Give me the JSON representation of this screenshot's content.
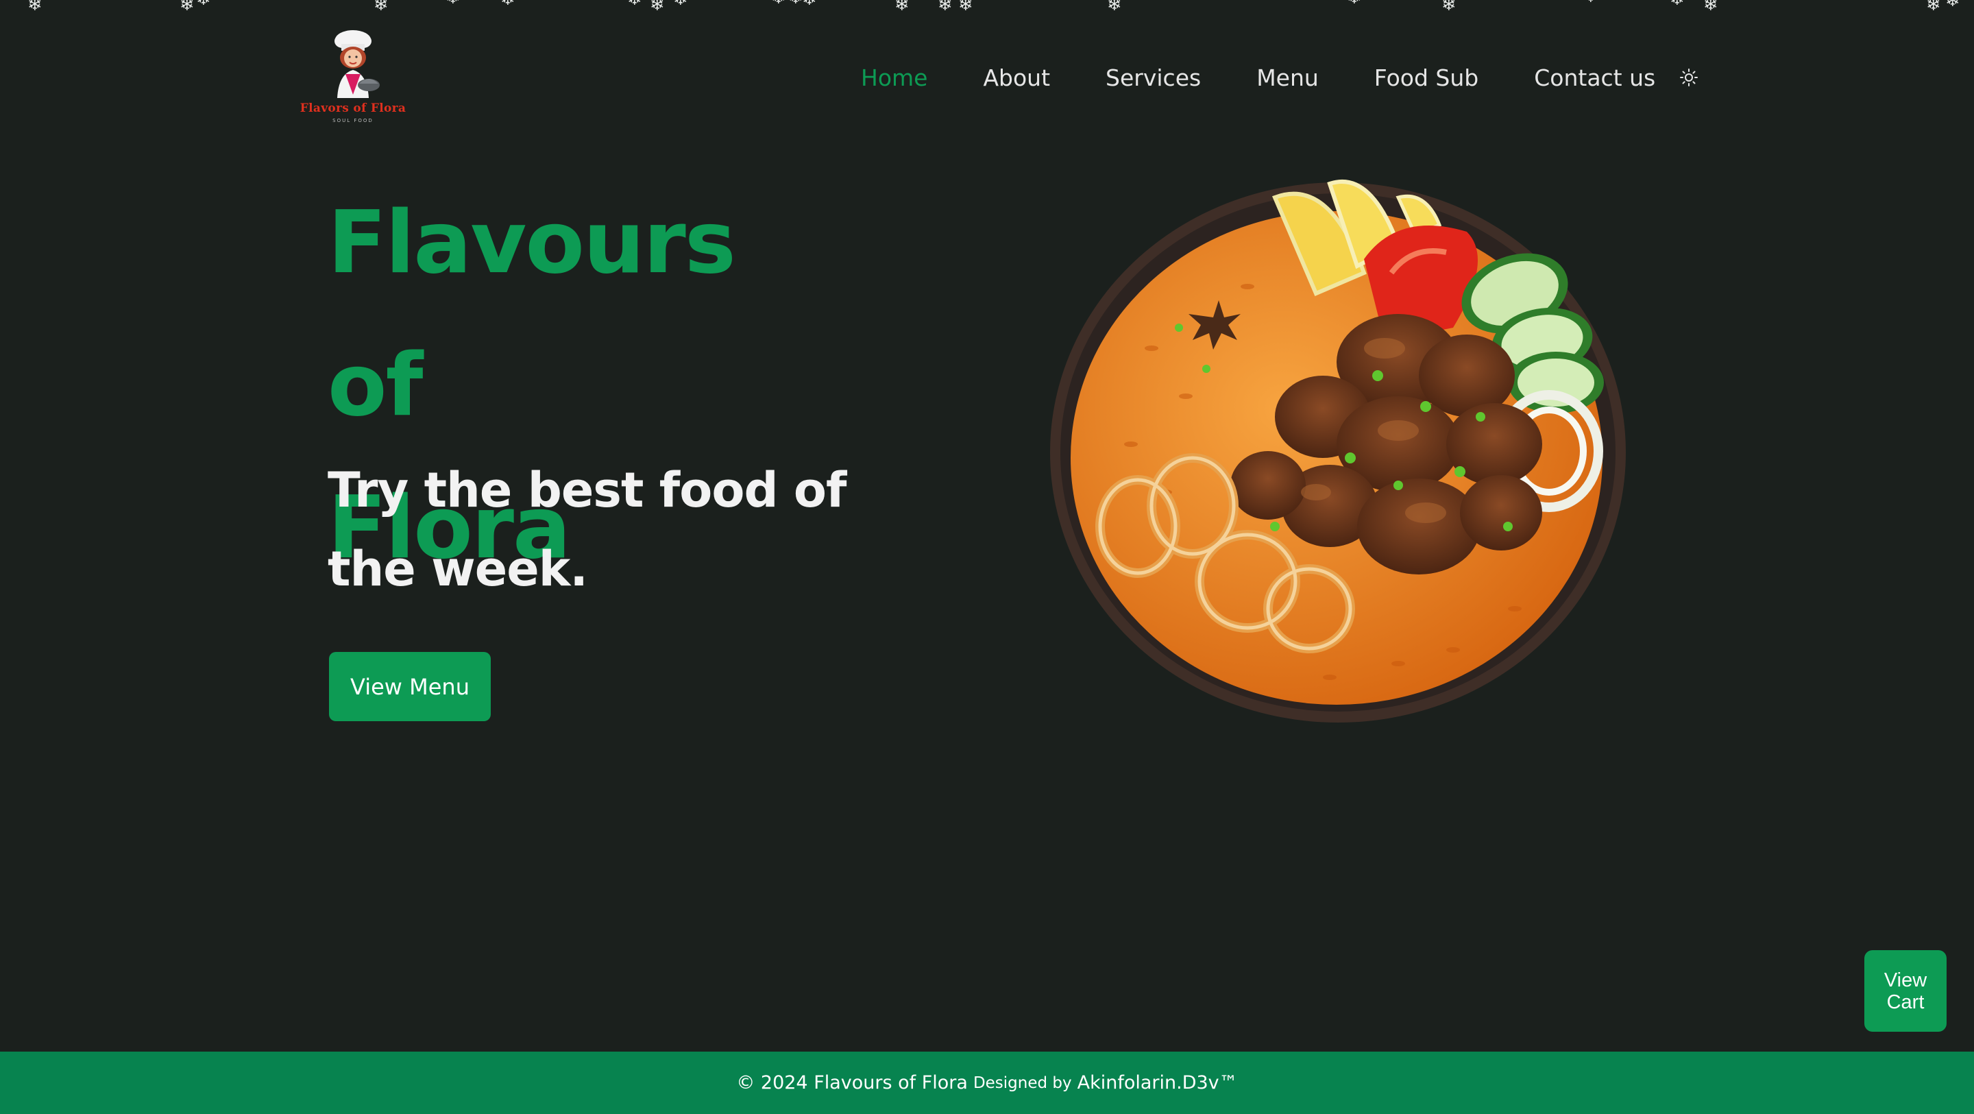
{
  "header": {
    "logo_name": "Flavors of Flora",
    "logo_tagline": "SOUL FOOD",
    "nav": [
      {
        "label": "Home",
        "active": true
      },
      {
        "label": "About"
      },
      {
        "label": "Services"
      },
      {
        "label": "Menu"
      },
      {
        "label": "Food Sub"
      },
      {
        "label": "Contact us"
      }
    ],
    "theme_toggle_icon": "sun-icon"
  },
  "hero": {
    "title_line1": "Flavours of",
    "title_line2": "Flora",
    "subtitle_line1": "Try the best food of",
    "subtitle_line2": "the week.",
    "cta_label": "View Menu",
    "image": "jollof-rice-dish"
  },
  "floating": {
    "cart_line1": "View",
    "cart_line2": "Cart"
  },
  "footer": {
    "copyright": "© 2024 Flavours of Flora",
    "designed_by": "Designed by",
    "author": "Akinfolarin.D3v™"
  },
  "colors": {
    "background": "#1b201d",
    "accent": "#0d9b54",
    "footer": "#07834f"
  },
  "decor": {
    "snowflake": "❄"
  }
}
